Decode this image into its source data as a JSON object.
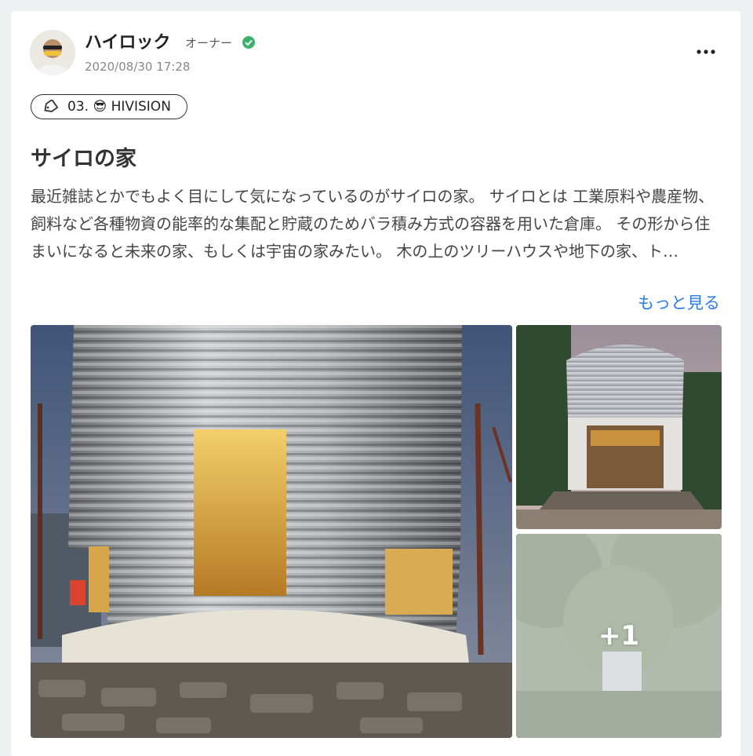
{
  "post": {
    "author": "ハイロック",
    "role": "オーナー",
    "date": "2020/08/30 17:28",
    "tag": "03. 😎 HIVISION",
    "title": "サイロの家",
    "body": "最近雑誌とかでもよく目にして気になっているのがサイロの家。 サイロとは 工業原料や農産物、飼料など各種物資の能率的な集配と貯蔵のためバラ積み方式の容器を用いた倉庫。 その形から住まいになると未来の家、もしくは宇宙の家みたい。 木の上のツリーハウスや地下の家、ト…",
    "read_more": "もっと見る",
    "extra_images": "+1"
  },
  "icons": {
    "verified": "check-badge-icon",
    "more": "ellipsis-icon",
    "tag": "tag-icon"
  },
  "colors": {
    "link": "#2c7be5",
    "verified": "#3bb26b"
  }
}
